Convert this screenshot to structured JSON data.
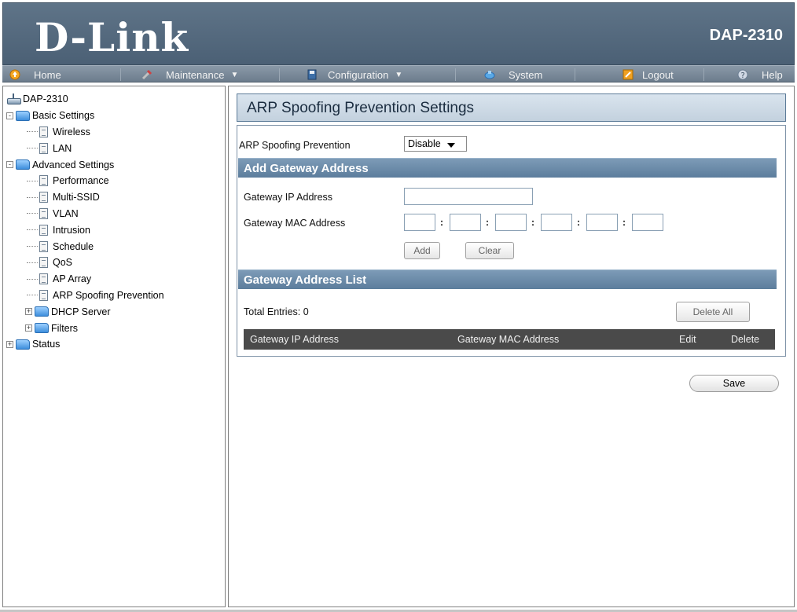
{
  "header": {
    "brand": "D-Link",
    "model": "DAP-2310"
  },
  "nav": {
    "items": [
      {
        "label": "Home",
        "icon": "home-icon"
      },
      {
        "label": "Maintenance",
        "icon": "tools-icon",
        "dropdown": "▼"
      },
      {
        "label": "Configuration",
        "icon": "save-disk-icon",
        "dropdown": "▼"
      },
      {
        "label": "System",
        "icon": "system-icon"
      },
      {
        "label": "Logout",
        "icon": "logout-icon"
      },
      {
        "label": "Help",
        "icon": "help-icon"
      }
    ]
  },
  "sidebar": {
    "root": "DAP-2310",
    "basic": {
      "label": "Basic Settings",
      "expander": "-",
      "children": [
        "Wireless",
        "LAN"
      ]
    },
    "advanced": {
      "label": "Advanced Settings",
      "expander": "-",
      "children": [
        "Performance",
        "Multi-SSID",
        "VLAN",
        "Intrusion",
        "Schedule",
        "QoS",
        "AP Array",
        "ARP Spoofing Prevention"
      ],
      "folders": [
        {
          "label": "DHCP Server",
          "expander": "+"
        },
        {
          "label": "Filters",
          "expander": "+"
        }
      ]
    },
    "status": {
      "label": "Status",
      "expander": "+"
    }
  },
  "main": {
    "title": "ARP Spoofing Prevention Settings",
    "arp_label": "ARP Spoofing Prevention",
    "arp_value": "Disable",
    "add_section": "Add Gateway Address",
    "gw_ip_label": "Gateway IP Address",
    "gw_ip_value": "",
    "gw_mac_label": "Gateway MAC Address",
    "mac_sep": ":",
    "add_button": "Add",
    "clear_button": "Clear",
    "list_section": "Gateway Address List",
    "total_entries": "Total Entries: 0",
    "delete_all_button": "Delete All",
    "columns": [
      "Gateway IP Address",
      "Gateway MAC Address",
      "Edit",
      "Delete"
    ],
    "save_button": "Save"
  }
}
